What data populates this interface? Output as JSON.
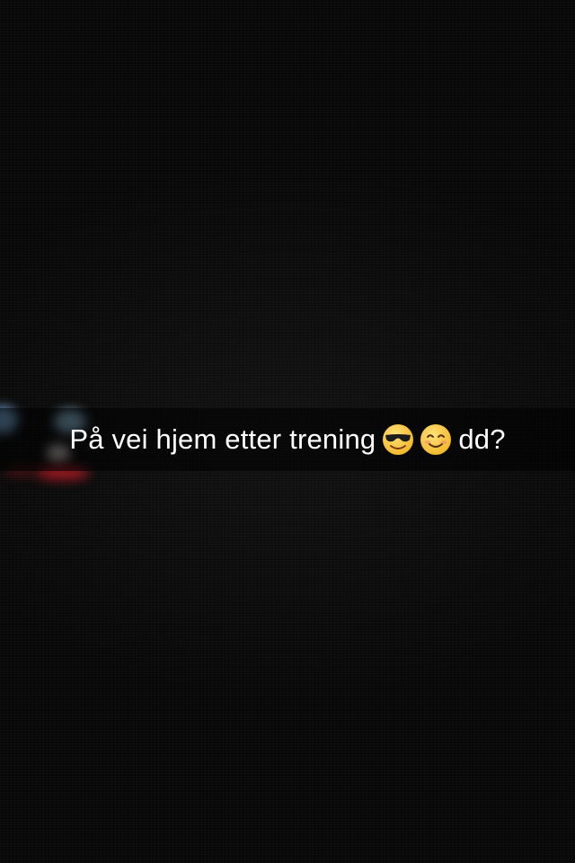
{
  "caption": {
    "text_before": "På vei hjem etter trening",
    "emojis": [
      "smiling-face-with-sunglasses-icon",
      "smiling-face-icon"
    ],
    "text_after": "dd?"
  },
  "colors": {
    "background": "#0b0b0b",
    "caption_text": "#ffffff",
    "caption_bar": "rgba(0,0,0,0.55)",
    "emoji_yellow": "#f6c13c"
  }
}
